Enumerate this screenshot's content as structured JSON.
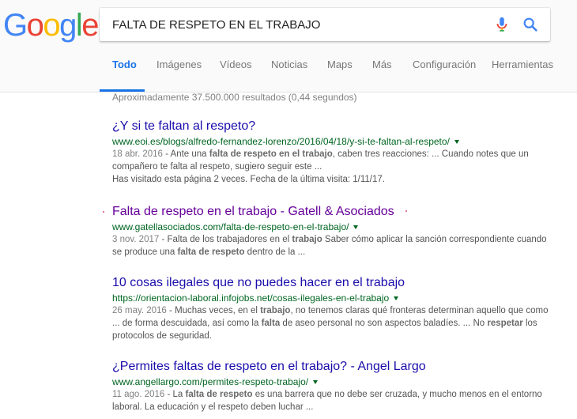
{
  "logo": {
    "letters": [
      {
        "char": "G",
        "color": "#4285f4"
      },
      {
        "char": "o",
        "color": "#ea4335"
      },
      {
        "char": "o",
        "color": "#fbbc05"
      },
      {
        "char": "g",
        "color": "#4285f4"
      },
      {
        "char": "l",
        "color": "#34a853"
      },
      {
        "char": "e",
        "color": "#ea4335"
      }
    ]
  },
  "search": {
    "value": "FALTA DE RESPETO EN EL TRABAJO",
    "mic_icon": "microphone-icon",
    "search_icon": "magnifier-icon"
  },
  "tabs": [
    {
      "label": "Todo",
      "active": true
    },
    {
      "label": "Imágenes",
      "active": false
    },
    {
      "label": "Vídeos",
      "active": false
    },
    {
      "label": "Noticias",
      "active": false
    },
    {
      "label": "Maps",
      "active": false
    },
    {
      "label": "Más",
      "active": false
    },
    {
      "label": "Configuración",
      "active": false
    },
    {
      "label": "Herramientas",
      "active": false
    }
  ],
  "stats": "Aproximadamente 37.500.000 resultados (0,44 segundos)",
  "results": [
    {
      "title": "¿Y si te faltan al respeto?",
      "url": "www.eoi.es/blogs/alfredo-fernandez-lorenzo/2016/04/18/y-si-te-faltan-al-respeto/",
      "date": "18 abr. 2016",
      "snippet_parts": [
        " - Ante una ",
        "falta de respeto en el trabajo",
        ", caben tres reacciones: ... Cuando notes que un compañero te falta al respeto, sugiero seguir este ..."
      ],
      "visited_note": "Has visitado esta página 2 veces. Fecha de la última visita: 1/11/17."
    },
    {
      "title": "Falta de respeto en el trabajo - Gatell & Asociados",
      "url": "www.gatellasociados.com/falta-de-respeto-en-el-trabajo/",
      "date": "3 nov. 2017",
      "snippet_parts": [
        " - Falta de los trabajadores en el ",
        "trabajo",
        " Saber cómo aplicar la sanción correspondiente cuando se produce una ",
        "falta de respeto",
        " dentro de la ..."
      ]
    },
    {
      "title": "10 cosas ilegales que no puedes hacer en el trabajo",
      "url": "https://orientacion-laboral.infojobs.net/cosas-ilegales-en-el-trabajo",
      "date": "26 may. 2016",
      "snippet_parts": [
        " - Muchas veces, en el ",
        "trabajo",
        ", no tenemos claras qué fronteras determinan aquello que como ... de forma descuidada, así como la ",
        "falta",
        " de aseo personal no son aspectos baladíes. ... No ",
        "respetar",
        " los protocolos de seguridad."
      ]
    },
    {
      "title": "¿Permites faltas de respeto en el trabajo? - Angel Largo",
      "url": "www.angellargo.com/permites-respeto-trabajo/",
      "date": "11 ago. 2016",
      "snippet_parts": [
        " - La ",
        "falta de respeto",
        " es una barrera que no debe ser cruzada, y mucho menos en el entorno laboral. La educación y el respeto deben luchar ..."
      ]
    }
  ],
  "colors": {
    "link": "#1a0dab",
    "visited": "#660099",
    "url_green": "#006621",
    "snippet": "#545454",
    "tab_active": "#1a73e8"
  }
}
